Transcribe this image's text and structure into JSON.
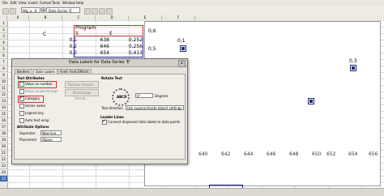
{
  "menu": [
    "File",
    "Edit",
    "View",
    "Insert",
    "Format",
    "Tools",
    "Window",
    "Help"
  ],
  "toolbar": {
    "name_box": "Wg_a...0",
    "object_select": "Data Series 'E'"
  },
  "sheet": {
    "columns": [
      "",
      "A",
      "B",
      "C",
      "D",
      "E",
      "F"
    ],
    "rows": [
      "1",
      "2",
      "3",
      "4",
      "5",
      "6",
      "7",
      "8",
      "9",
      "10",
      "11",
      "12",
      "13",
      "14",
      "15",
      "16",
      "17",
      "18",
      "19",
      "20",
      "21",
      "22",
      "23",
      "24",
      "25"
    ],
    "cells": {
      "b2": "C",
      "program": "Program",
      "s": "S",
      "e": "E",
      "r1": {
        "a": "0,1",
        "b": "638",
        "c": "0,252"
      },
      "r2": {
        "a": "0,2",
        "b": "646",
        "c": "0,256"
      },
      "r3": {
        "a": "0,3",
        "b": "654",
        "c": "0,413"
      }
    }
  },
  "chart": {
    "y_ticks": [
      "0,6",
      "0,5"
    ],
    "x_ticks": [
      "640",
      "642",
      "644",
      "646",
      "648",
      "650",
      "652",
      "654",
      "656"
    ]
  },
  "chart_data": {
    "type": "scatter",
    "x": [
      638,
      654
    ],
    "y": [
      0.5,
      0.3
    ],
    "labels": [
      "0,1",
      "0,3"
    ],
    "xlim": [
      636,
      656
    ]
  },
  "dialog": {
    "title": "Data Labels for Data Series 'E'",
    "close": "x",
    "tabs": [
      "Borders",
      "Data Labels",
      "Font",
      "Font Effects"
    ],
    "text_attributes": "Text Attributes",
    "show_value_number": "Value as number",
    "show_value_percentage": "Value as percentage",
    "show_category": "Category",
    "show_series_name": "Series name",
    "show_legend_key": "Legend key",
    "auto_text_wrap": "Auto text wrap",
    "number_format": "Number format...",
    "percentage_format": "Percentage format...",
    "attribute_options": "Attribute Options",
    "separator_label": "Separator",
    "separator_value": "New line",
    "placement_label": "Placement",
    "placement_value": "Above",
    "rotate_text": "Rotate Text",
    "dial_label": "ABCD",
    "degrees_value": "0°",
    "degrees_label": "Degrees",
    "text_direction_label": "Text direction",
    "text_direction_value": "Use superordinate object settings",
    "leader_lines": "Leader Lines",
    "connect_label": "Connect displaced data labels to data points"
  }
}
